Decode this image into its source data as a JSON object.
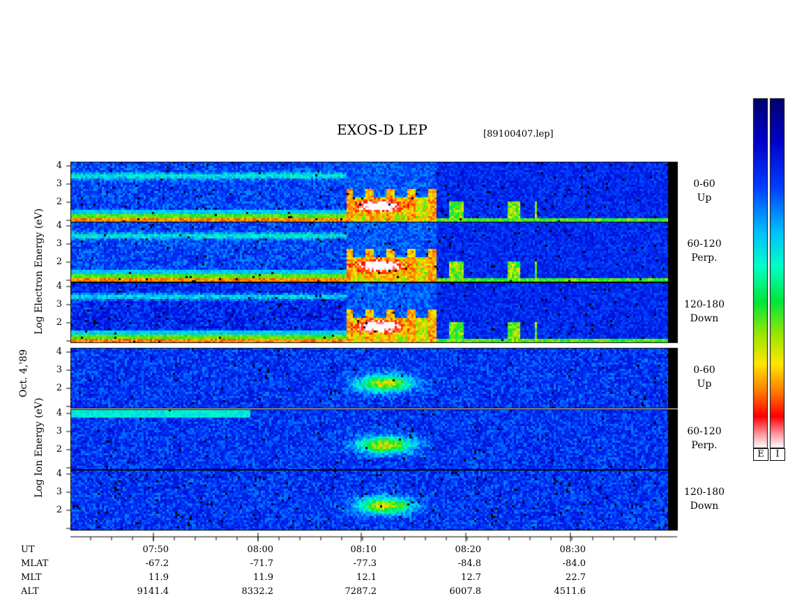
{
  "title": "EXOS-D LEP",
  "filename": "[89100407.lep]",
  "date_label": "Oct. 4,'89",
  "electron_axis_label": "Log  Electron  Energy (eV)",
  "ion_axis_label": "Log  Ion  Energy (eV)",
  "colorbar": {
    "labels": [
      "E",
      "I"
    ]
  },
  "chart_data": {
    "type": "heatmap",
    "panels": [
      {
        "species": "Electron",
        "pitch_angle": "0-60",
        "direction": "Up"
      },
      {
        "species": "Electron",
        "pitch_angle": "60-120",
        "direction": "Perp."
      },
      {
        "species": "Electron",
        "pitch_angle": "120-180",
        "direction": "Down"
      },
      {
        "species": "Ion",
        "pitch_angle": "0-60",
        "direction": "Up"
      },
      {
        "species": "Ion",
        "pitch_angle": "60-120",
        "direction": "Perp."
      },
      {
        "species": "Ion",
        "pitch_angle": "120-180",
        "direction": "Down"
      }
    ],
    "y_ticks": [
      "4",
      "3",
      "2"
    ],
    "ylim": [
      1,
      4
    ],
    "x_axis": {
      "label": "UT",
      "ticks": [
        "07:50",
        "08:00",
        "08:10",
        "08:20",
        "08:30"
      ]
    },
    "ephemeris": [
      {
        "name": "UT",
        "values": [
          "07:50",
          "08:00",
          "08:10",
          "08:20",
          "08:30"
        ]
      },
      {
        "name": "MLAT",
        "values": [
          "-67.2",
          "-71.7",
          "-77.3",
          "-84.8",
          "-84.0"
        ]
      },
      {
        "name": "MLT",
        "values": [
          "11.9",
          "11.9",
          "12.1",
          "12.7",
          "22.7"
        ]
      },
      {
        "name": "ALT",
        "values": [
          "9141.4",
          "8332.2",
          "7287.2",
          "6007.8",
          "4511.6"
        ]
      }
    ]
  }
}
